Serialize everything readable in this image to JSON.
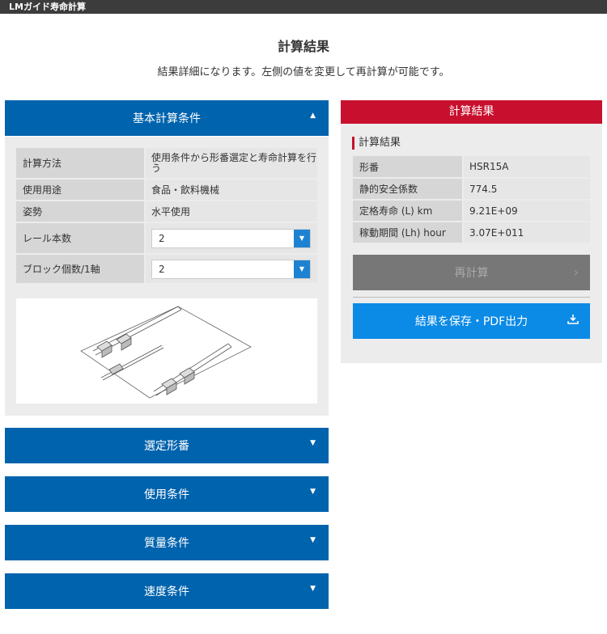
{
  "app": {
    "title": "LMガイド寿命計算"
  },
  "header": {
    "title": "計算結果",
    "subtitle": "結果詳細になります。左側の値を変更して再計算が可能です。"
  },
  "basic": {
    "title": "基本計算条件",
    "caret_icon": "caret-up-icon",
    "rows": [
      {
        "label": "計算方法",
        "value": "使用条件から形番選定と寿命計算を行う"
      },
      {
        "label": "使用用途",
        "value": "食品・飲料機械"
      },
      {
        "label": "姿勢",
        "value": "水平使用"
      }
    ],
    "rail_count": {
      "label": "レール本数",
      "value": "2"
    },
    "block_count": {
      "label": "ブロック個数/1軸",
      "value": "2"
    }
  },
  "sections": [
    {
      "title": "選定形番"
    },
    {
      "title": "使用条件"
    },
    {
      "title": "質量条件"
    },
    {
      "title": "速度条件"
    }
  ],
  "results": {
    "header": "計算結果",
    "subtitle": "計算結果",
    "rows": [
      {
        "label": "形番",
        "value": "HSR15A"
      },
      {
        "label": "静的安全係数",
        "value": "774.5"
      },
      {
        "label": "定格寿命 (L) km",
        "value": "9.21E+09"
      },
      {
        "label": "稼動期間 (Lh) hour",
        "value": "3.07E+011"
      }
    ],
    "recalc_label": "再計算",
    "save_label": "結果を保存・PDF出力"
  },
  "colors": {
    "blue": "#0063ad",
    "red": "#c8102e",
    "save": "#0b8ae6",
    "gray_button": "#777777"
  }
}
